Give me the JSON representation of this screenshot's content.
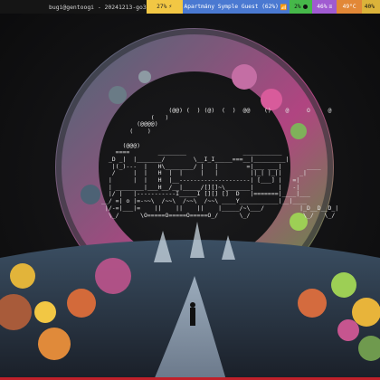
{
  "statusbar": {
    "title": "bugi@gentoogi - 20241213-go3",
    "battery": "27%",
    "wifi": "Apartmány Symple Guest (62%)",
    "volume": "2%",
    "memory": "46%",
    "temperature": "49°C",
    "cpu": "40%"
  },
  "terminal": {
    "lines": [
      "                   (@@) (  ) (@)  (  )  @@    ()    @     O     @",
      "              (   )",
      "          (@@@@)",
      "        (    )",
      "",
      "      (@@@)",
      "    ====        ________                ___________",
      "  _D _|  |_______/        \\__I_I_____===__|_________|",
      "   |(_)---  |   H\\________/ |   |        =|___ ___|       ____",
      "   /     |  |   H  |  |     |   |         ||_| |_||     _|",
      "  |      |  |   H  |__--------------------| [___] |   =|",
      "  | ________|___H__/__|_____/[][]~\\_______|       |   -|",
      "  |/ |   |-----------I_____I [][] []  D   |=======|____|___",
      "__/ =| o |=-~~\\  /~~\\  /~~\\  /~~\\ ____Y___________|__|____",
      " |/-=|___|=    ||    ||    ||    |_____/~\\___/          |_D__D__D_|",
      "  \\_/      \\O=====O=====O=====O_/      \\_/               \\_/   \\_/"
    ]
  }
}
